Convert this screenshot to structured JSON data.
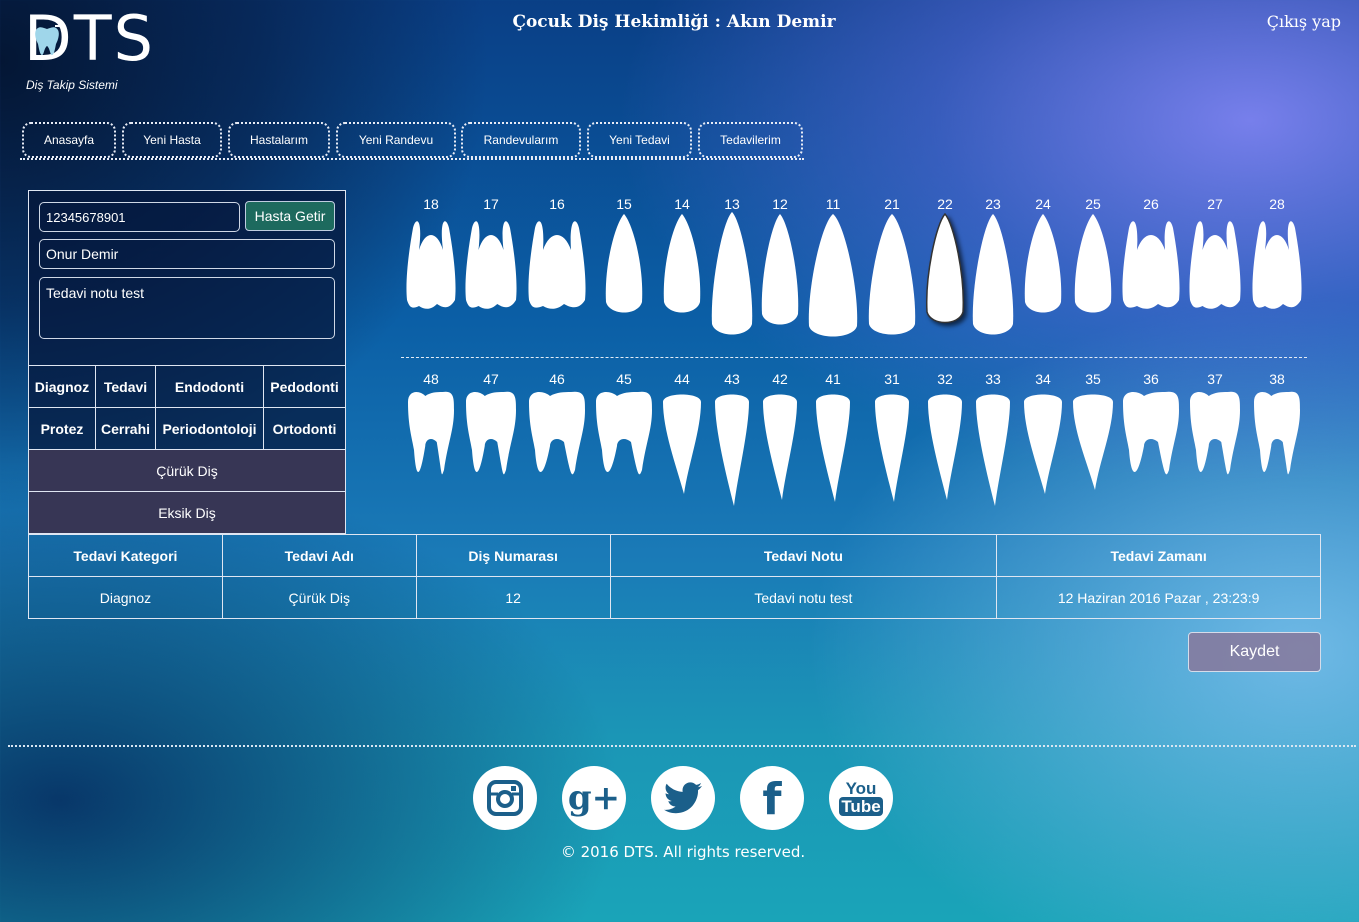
{
  "header": {
    "logo_text": "DTS",
    "logo_subtitle": "Diş Takip Sistemi",
    "title": "Çocuk Diş Hekimliği : Akın Demir",
    "logout_label": "Çıkış yap"
  },
  "nav": [
    {
      "label": "Anasayfa"
    },
    {
      "label": "Yeni Hasta"
    },
    {
      "label": "Hastalarım"
    },
    {
      "label": "Yeni Randevu"
    },
    {
      "label": "Randevularım"
    },
    {
      "label": "Yeni Tedavi"
    },
    {
      "label": "Tedavilerim"
    }
  ],
  "patient": {
    "id_value": "12345678901",
    "fetch_button": "Hasta Getir",
    "name_value": "Onur Demir",
    "note_value": "Tedavi notu test"
  },
  "categories": {
    "row1": [
      "Diagnoz",
      "Tedavi",
      "Endodonti",
      "Pedodonti"
    ],
    "row2": [
      "Protez",
      "Cerrahi",
      "Periodontoloji",
      "Ortodonti"
    ]
  },
  "sub_items": [
    "Çürük Diş",
    "Eksik Diş"
  ],
  "teeth": {
    "upper": [
      "18",
      "17",
      "16",
      "15",
      "14",
      "13",
      "12",
      "11",
      "21",
      "22",
      "23",
      "24",
      "25",
      "26",
      "27",
      "28"
    ],
    "lower": [
      "48",
      "47",
      "46",
      "45",
      "44",
      "43",
      "42",
      "41",
      "31",
      "32",
      "33",
      "34",
      "35",
      "36",
      "37",
      "38"
    ],
    "selected": "22"
  },
  "table": {
    "headers": [
      "Tedavi Kategori",
      "Tedavi Adı",
      "Diş Numarası",
      "Tedavi Notu",
      "Tedavi Zamanı"
    ],
    "rows": [
      [
        "Diagnoz",
        "Çürük Diş",
        "12",
        "Tedavi notu test",
        "12 Haziran 2016 Pazar , 23:23:9"
      ]
    ]
  },
  "save_label": "Kaydet",
  "social": [
    {
      "icon": "instagram-icon"
    },
    {
      "icon": "google-plus-icon",
      "glyph": "g+"
    },
    {
      "icon": "twitter-icon"
    },
    {
      "icon": "facebook-icon",
      "glyph": "f"
    },
    {
      "icon": "youtube-icon",
      "glyph_top": "You",
      "glyph_bottom": "Tube"
    }
  ],
  "copyright": "© 2016 DTS. All rights reserved.",
  "colors": {
    "hasta_getir_button": "#1d6a5e",
    "kaydet_button": "#877899",
    "subitem_bg": "#3c3755",
    "social_icon": "#1b5f8a"
  }
}
